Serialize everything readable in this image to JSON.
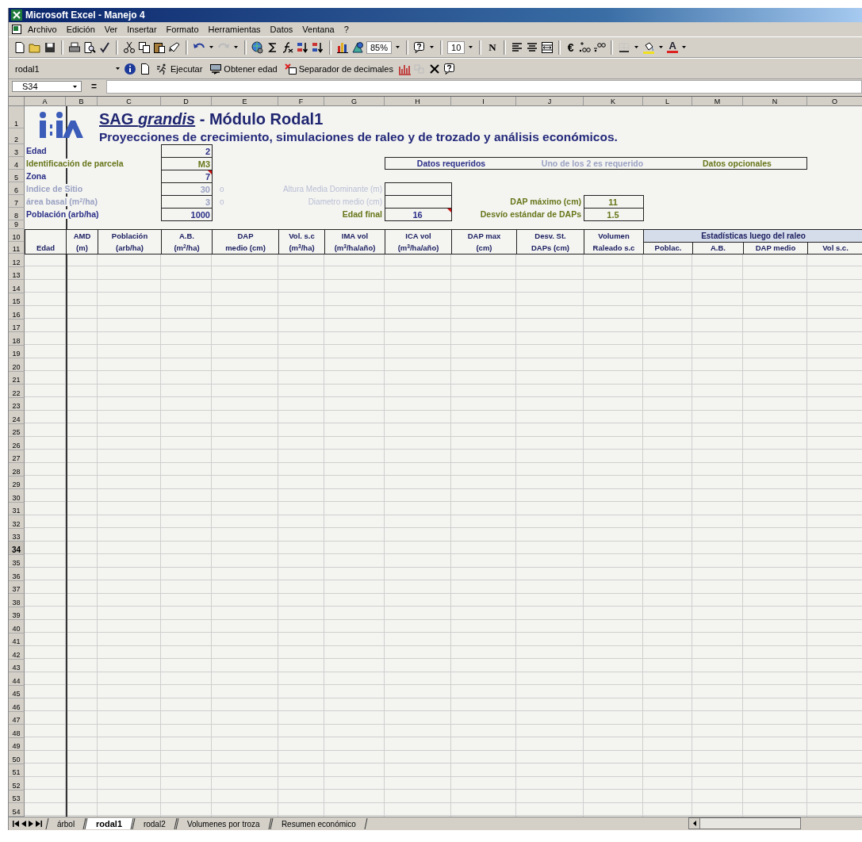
{
  "window": {
    "title": "Microsoft Excel - Manejo 4"
  },
  "menu": [
    "Archivo",
    "Edición",
    "Ver",
    "Insertar",
    "Formato",
    "Herramientas",
    "Datos",
    "Ventana",
    "?"
  ],
  "toolbar": {
    "zoom": "85%",
    "font_size": "10",
    "bold": "N",
    "currency": "€",
    "font_color": "A"
  },
  "custom_toolbar": {
    "macro": "rodal1",
    "buttons": [
      {
        "label": "Ejecutar",
        "kind": "run"
      },
      {
        "label": "Obtener edad",
        "kind": "age"
      },
      {
        "label": "Separador de decimales",
        "kind": "decimal"
      }
    ]
  },
  "formula_bar": {
    "name_box": "S34",
    "equals": "="
  },
  "columns": [
    "A",
    "B",
    "C",
    "D",
    "E",
    "F",
    "G",
    "H",
    "I",
    "J",
    "K",
    "L",
    "M",
    "N",
    "O"
  ],
  "row_headers": [
    {
      "label": "1",
      "selected": false
    },
    {
      "label": "2",
      "selected": false
    },
    {
      "label": "3",
      "selected": false
    },
    {
      "label": "4",
      "selected": false
    },
    {
      "label": "5",
      "selected": false
    },
    {
      "label": "6",
      "selected": false
    },
    {
      "label": "7",
      "selected": false
    },
    {
      "label": "8",
      "selected": false
    },
    {
      "label": "9",
      "selected": false
    },
    {
      "label": "10",
      "selected": false
    },
    {
      "label": "11",
      "selected": false
    },
    {
      "label": "12",
      "selected": false
    },
    {
      "label": "13",
      "selected": false
    },
    {
      "label": "14",
      "selected": false
    },
    {
      "label": "15",
      "selected": false
    },
    {
      "label": "16",
      "selected": false
    },
    {
      "label": "17",
      "selected": false
    },
    {
      "label": "18",
      "selected": false
    },
    {
      "label": "19",
      "selected": false
    },
    {
      "label": "20",
      "selected": false
    },
    {
      "label": "21",
      "selected": false
    },
    {
      "label": "22",
      "selected": false
    },
    {
      "label": "23",
      "selected": false
    },
    {
      "label": "24",
      "selected": false
    },
    {
      "label": "25",
      "selected": false
    },
    {
      "label": "26",
      "selected": false
    },
    {
      "label": "27",
      "selected": false
    },
    {
      "label": "28",
      "selected": false
    },
    {
      "label": "29",
      "selected": false
    },
    {
      "label": "30",
      "selected": false
    },
    {
      "label": "31",
      "selected": false
    },
    {
      "label": "32",
      "selected": false
    },
    {
      "label": "33",
      "selected": false
    },
    {
      "label": "34",
      "selected": true
    },
    {
      "label": "35",
      "selected": false
    },
    {
      "label": "36",
      "selected": false
    },
    {
      "label": "37",
      "selected": false
    },
    {
      "label": "38",
      "selected": false
    },
    {
      "label": "39",
      "selected": false
    },
    {
      "label": "40",
      "selected": false
    },
    {
      "label": "41",
      "selected": false
    },
    {
      "label": "42",
      "selected": false
    },
    {
      "label": "43",
      "selected": false
    },
    {
      "label": "44",
      "selected": false
    },
    {
      "label": "45",
      "selected": false
    },
    {
      "label": "46",
      "selected": false
    },
    {
      "label": "47",
      "selected": false
    },
    {
      "label": "48",
      "selected": false
    },
    {
      "label": "49",
      "selected": false
    },
    {
      "label": "50",
      "selected": false
    },
    {
      "label": "51",
      "selected": false
    },
    {
      "label": "52",
      "selected": false
    },
    {
      "label": "53",
      "selected": false
    },
    {
      "label": "54",
      "selected": false
    }
  ],
  "sheet": {
    "title_prefix": "SAG *grandis*",
    "title_suffix": "- Módulo Rodal1",
    "subtitle": "Proyecciones de crecimiento, simulaciones de raleo y de trozado y análisis económicos.",
    "inputs": [
      {
        "label": "Edad",
        "value": "2",
        "kind": "required",
        "comment": false
      },
      {
        "label": "Identificación de parcela",
        "value": "M3",
        "kind": "optional",
        "comment": false
      },
      {
        "label": "Zona",
        "value": "7",
        "kind": "required",
        "comment": true
      },
      {
        "label": "Indice de Sitio",
        "value": "30",
        "kind": "either",
        "comment": false
      },
      {
        "label": "área basal (m$^{2}$/ha)",
        "value": "3",
        "kind": "either",
        "comment": false
      },
      {
        "label": "Población (arb/ha)",
        "value": "1000",
        "kind": "required",
        "comment": false
      }
    ],
    "alternatives": [
      {
        "separator": "o",
        "label": "Altura Media Dominante (m)"
      },
      {
        "separator": "o",
        "label": "Diametro medio (cm)"
      }
    ],
    "legend": [
      {
        "text": "Datos requeridos",
        "kind": "required"
      },
      {
        "text": "Uno de los 2 es requerido",
        "kind": "either"
      },
      {
        "text": "Datos opcionales",
        "kind": "optional"
      }
    ],
    "final_age": {
      "label": "Edad final",
      "value": "16",
      "comment": true
    },
    "dap": [
      {
        "label": "DAP máximo (cm)",
        "value": "11"
      },
      {
        "label": "Desvío estándar de DAPs",
        "value": "1.5"
      }
    ],
    "table_headers": [
      {
        "lines": [
          "Edad"
        ]
      },
      {
        "lines": [
          "AMD",
          "(m)"
        ]
      },
      {
        "lines": [
          "Población",
          "(arb/ha)"
        ]
      },
      {
        "lines": [
          "A.B.",
          "(m$^{2}$/ha)"
        ]
      },
      {
        "lines": [
          "DAP",
          "medio (cm)"
        ]
      },
      {
        "lines": [
          "Vol. s.c",
          "(m$^{3}$/ha)"
        ]
      },
      {
        "lines": [
          "IMA vol",
          "(m$^{3}$/ha/año)"
        ]
      },
      {
        "lines": [
          "ICA vol",
          "(m$^{3}$/ha/año)"
        ]
      },
      {
        "lines": [
          "DAP max",
          "(cm)"
        ]
      },
      {
        "lines": [
          "Desv. St.",
          "DAPs (cm)"
        ]
      },
      {
        "lines": [
          "Volumen",
          "Raleado s.c"
        ]
      }
    ],
    "group_header": "Estadísticas luego del raleo",
    "group_subheaders": [
      "Poblac.",
      "A.B.",
      "DAP medio",
      "Vol s.c."
    ]
  },
  "sheet_tabs": [
    {
      "label": "árbol",
      "selected": false
    },
    {
      "label": "rodal1",
      "selected": true
    },
    {
      "label": "rodal2",
      "selected": false
    },
    {
      "label": "Volumenes por troza",
      "selected": false
    },
    {
      "label": "Resumen económico",
      "selected": false
    }
  ]
}
